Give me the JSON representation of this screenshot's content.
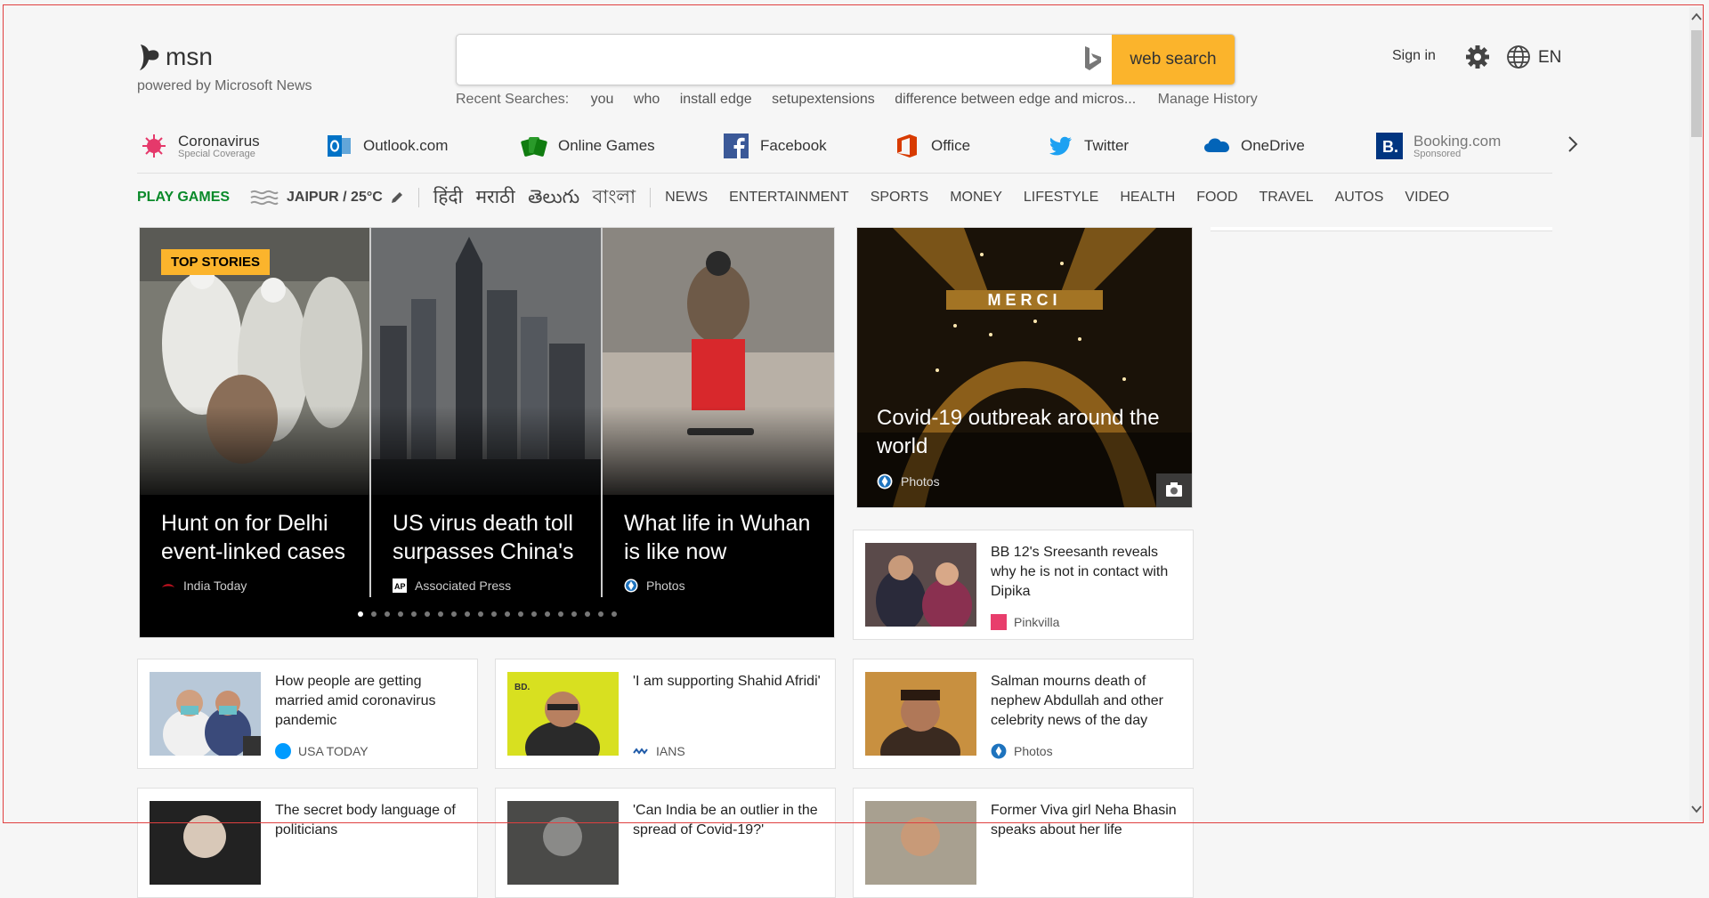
{
  "header": {
    "logo_text": "msn",
    "powered_by": "powered by Microsoft News",
    "search_placeholder": "",
    "search_button": "web search",
    "recent_label": "Recent Searches:",
    "recent_searches": [
      "you",
      "who",
      "install edge",
      "setupextensions",
      "difference between edge and micros..."
    ],
    "manage_history": "Manage History",
    "sign_in": "Sign in",
    "language": "EN"
  },
  "quick_links": [
    {
      "label": "Coronavirus",
      "sub": "Special Coverage",
      "icon": "coronavirus-icon",
      "color": "#e5396b"
    },
    {
      "label": "Outlook.com",
      "sub": "",
      "icon": "outlook-icon",
      "color": "#0072c6"
    },
    {
      "label": "Online Games",
      "sub": "",
      "icon": "games-icon",
      "color": "#107c10"
    },
    {
      "label": "Facebook",
      "sub": "",
      "icon": "facebook-icon",
      "color": "#3b5998"
    },
    {
      "label": "Office",
      "sub": "",
      "icon": "office-icon",
      "color": "#d83b01"
    },
    {
      "label": "Twitter",
      "sub": "",
      "icon": "twitter-icon",
      "color": "#1da1f2"
    },
    {
      "label": "OneDrive",
      "sub": "",
      "icon": "onedrive-icon",
      "color": "#0364b8"
    },
    {
      "label": "Booking.com",
      "sub": "Sponsored",
      "icon": "booking-icon",
      "color": "#003580"
    }
  ],
  "nav": {
    "play_games": "PLAY GAMES",
    "weather": "JAIPUR / 25°C",
    "languages": [
      "हिंदी",
      "मराठी",
      "తెలుగు",
      "বাংলা"
    ],
    "categories": [
      "NEWS",
      "ENTERTAINMENT",
      "SPORTS",
      "MONEY",
      "LIFESTYLE",
      "HEALTH",
      "FOOD",
      "TRAVEL",
      "AUTOS",
      "VIDEO"
    ]
  },
  "top_stories": {
    "badge": "TOP STORIES",
    "slides": [
      {
        "headline": "Hunt on for Delhi event-linked cases",
        "source": "India Today"
      },
      {
        "headline": "US virus death toll surpasses China's",
        "source": "Associated Press"
      },
      {
        "headline": "What life in Wuhan is like now",
        "source": "Photos"
      }
    ],
    "dot_count": 20,
    "active_dot": 0
  },
  "feature": {
    "headline": "Covid-19 outbreak around the world",
    "source": "Photos",
    "sign_text": "MERCI"
  },
  "cards": [
    {
      "title": "BB 12's Sreesanth reveals why he is not in contact with Dipika",
      "source": "Pinkvilla"
    },
    {
      "title": "How people are getting married amid coronavirus pandemic",
      "source": "USA TODAY"
    },
    {
      "title": "'I am supporting Shahid Afridi'",
      "source": "IANS"
    },
    {
      "title": "Salman mourns death of nephew Abdullah and other celebrity news of the day",
      "source": "Photos"
    },
    {
      "title": "The secret body language of politicians",
      "source": ""
    },
    {
      "title": "'Can India be an outlier in the spread of Covid-19?'",
      "source": ""
    },
    {
      "title": "Former Viva girl Neha Bhasin speaks about her life",
      "source": ""
    }
  ]
}
